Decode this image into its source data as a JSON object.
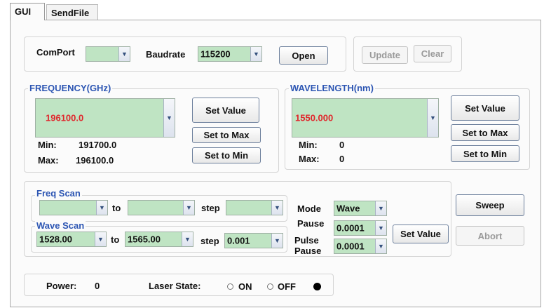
{
  "tabs": {
    "gui": "GUI",
    "sendfile": "SendFile"
  },
  "connection": {
    "comport_label": "ComPort",
    "comport_value": "",
    "baudrate_label": "Baudrate",
    "baudrate_value": "115200",
    "open_button": "Open",
    "update_button": "Update",
    "clear_button": "Clear"
  },
  "frequency": {
    "title": "FREQUENCY(GHz)",
    "value": "196100.0",
    "min_label": "Min:",
    "min_value": "191700.0",
    "max_label": "Max:",
    "max_value": "196100.0",
    "set_value": "Set Value",
    "set_max": "Set to Max",
    "set_min": "Set to Min"
  },
  "wavelength": {
    "title": "WAVELENGTH(nm)",
    "value": "1550.000",
    "min_label": "Min:",
    "min_value": "0",
    "max_label": "Max:",
    "max_value": "0",
    "set_value": "Set Value",
    "set_max": "Set to Max",
    "set_min": "Set to Min"
  },
  "freq_scan": {
    "title": "Freq Scan",
    "from_value": "",
    "to_label": "to",
    "to_value": "",
    "step_label": "step",
    "step_value": ""
  },
  "wave_scan": {
    "title": "Wave Scan",
    "from_value": "1528.00",
    "to_label": "to",
    "to_value": "1565.00",
    "step_label": "step",
    "step_value": "0.001"
  },
  "sweep_settings": {
    "mode_label": "Mode",
    "mode_value": "Wave",
    "pause_label": "Pause",
    "pause_value": "0.0001",
    "pulse_pause_label_1": "Pulse",
    "pulse_pause_label_2": "Pause",
    "pulse_pause_value": "0.0001",
    "set_value": "Set Value",
    "sweep_button": "Sweep",
    "abort_button": "Abort"
  },
  "status": {
    "power_label": "Power:",
    "power_value": "0",
    "laser_state_label": "Laser State:",
    "on_label": "ON",
    "off_label": "OFF"
  },
  "colors": {
    "accent_title": "#2d56b3",
    "display_red": "#e0262c",
    "combo_green": "#bfe4c3"
  },
  "icons": [
    "chevron-down-icon",
    "radio-icon",
    "status-led-icon"
  ]
}
